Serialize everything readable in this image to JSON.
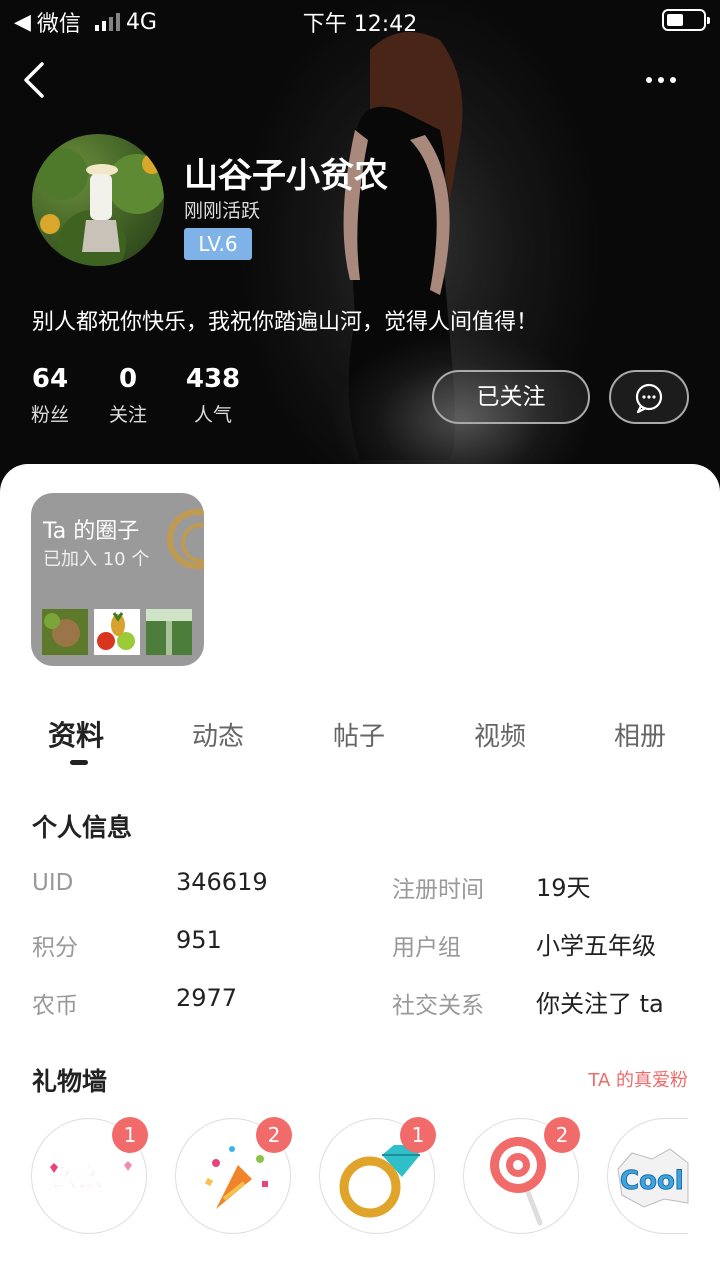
{
  "status": {
    "carrier": "微信",
    "network": "4G",
    "time": "下午 12:42"
  },
  "profile": {
    "name": "山谷子小贫农",
    "activity": "刚刚活跃",
    "level": "LV.6",
    "bio": "别人都祝你快乐，我祝你踏遍山河，觉得人间值得！",
    "stats": [
      {
        "value": "64",
        "label": "粉丝"
      },
      {
        "value": "0",
        "label": "关注"
      },
      {
        "value": "438",
        "label": "人气"
      }
    ],
    "follow_label": "已关注"
  },
  "circle": {
    "title": "Ta 的圈子",
    "subtitle": "已加入 10 个"
  },
  "tabs": [
    "资料",
    "动态",
    "帖子",
    "视频",
    "相册"
  ],
  "personal_info": {
    "title": "个人信息",
    "rows": [
      {
        "label": "UID",
        "value": "346619"
      },
      {
        "label": "积分",
        "value": "951"
      },
      {
        "label": "农币",
        "value": "2977"
      },
      {
        "label": "注册时间",
        "value": "19天"
      },
      {
        "label": "用户组",
        "value": "小学五年级"
      },
      {
        "label": "社交关系",
        "value": "你关注了 ta"
      }
    ]
  },
  "gift_wall": {
    "title": "礼物墙",
    "link": "TA 的真爱粉",
    "gifts": [
      {
        "icon": "kiss-text-icon",
        "text": "么么哒",
        "count": "1"
      },
      {
        "icon": "party-popper-icon",
        "count": "2"
      },
      {
        "icon": "diamond-ring-icon",
        "count": "1"
      },
      {
        "icon": "lollipop-icon",
        "count": "2"
      },
      {
        "icon": "cool-text-icon",
        "text": "Cool"
      }
    ]
  },
  "colors": {
    "level_badge": "#7fb3e8",
    "gift_badge": "#f26b6b",
    "link": "#f06a6a"
  }
}
